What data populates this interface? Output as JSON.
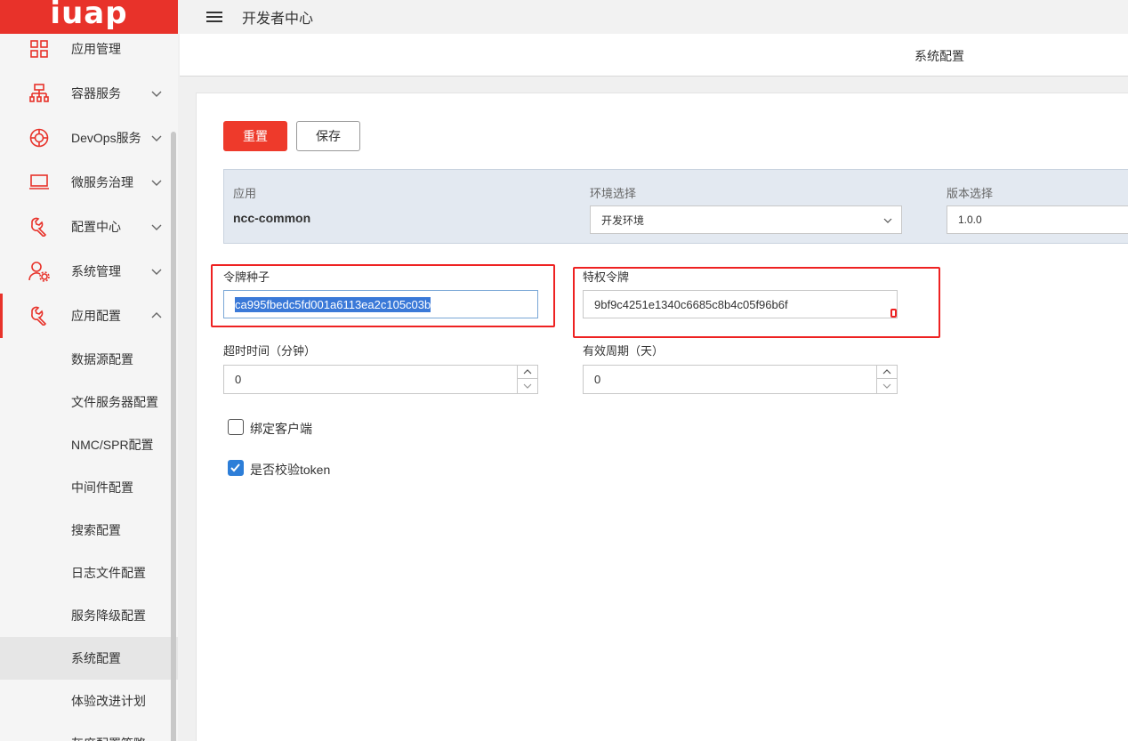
{
  "logo": "iuap",
  "topbar": {
    "title": "开发者中心"
  },
  "page": {
    "title": "系统配置"
  },
  "sidebar": {
    "items": [
      {
        "label": "应用管理",
        "icon": "grid-icon"
      },
      {
        "label": "容器服务",
        "icon": "sitemap-icon"
      },
      {
        "label": "DevOps服务",
        "icon": "lifebuoy-icon"
      },
      {
        "label": "微服务治理",
        "icon": "laptop-icon"
      },
      {
        "label": "配置中心",
        "icon": "wrench-icon"
      },
      {
        "label": "系统管理",
        "icon": "user-gear-icon"
      },
      {
        "label": "应用配置",
        "icon": "wrench-icon"
      }
    ],
    "sub_items": [
      {
        "label": "数据源配置"
      },
      {
        "label": "文件服务器配置"
      },
      {
        "label": "NMC/SPR配置"
      },
      {
        "label": "中间件配置"
      },
      {
        "label": "搜索配置"
      },
      {
        "label": "日志文件配置"
      },
      {
        "label": "服务降级配置"
      },
      {
        "label": "系统配置",
        "active": true
      },
      {
        "label": "体验改进计划"
      },
      {
        "label": "灰度配置策略"
      }
    ]
  },
  "toolbar": {
    "reset_label": "重置",
    "save_label": "保存"
  },
  "info": {
    "app_label": "应用",
    "app_value": "ncc-common",
    "env_label": "环境选择",
    "env_value": "开发环境",
    "version_label": "版本选择",
    "version_value": "1.0.0"
  },
  "form": {
    "token_seed_label": "令牌种子",
    "token_seed_value": "ca995fbedc5fd001a6113ea2c105c03b",
    "privileged_token_label": "特权令牌",
    "privileged_token_value": "9bf9c4251e1340c6685c8b4c05f96b6f",
    "timeout_label": "超时时间（分钟）",
    "timeout_value": "0",
    "validity_label": "有效周期（天）",
    "validity_value": "0",
    "bind_client_label": "绑定客户端",
    "bind_client_checked": false,
    "verify_token_label": "是否校验token",
    "verify_token_checked": true
  },
  "colors": {
    "brand": "#e8322a",
    "primary_button": "#ee3a2b",
    "checkbox": "#2d7ed8",
    "highlight": "#e22222"
  }
}
